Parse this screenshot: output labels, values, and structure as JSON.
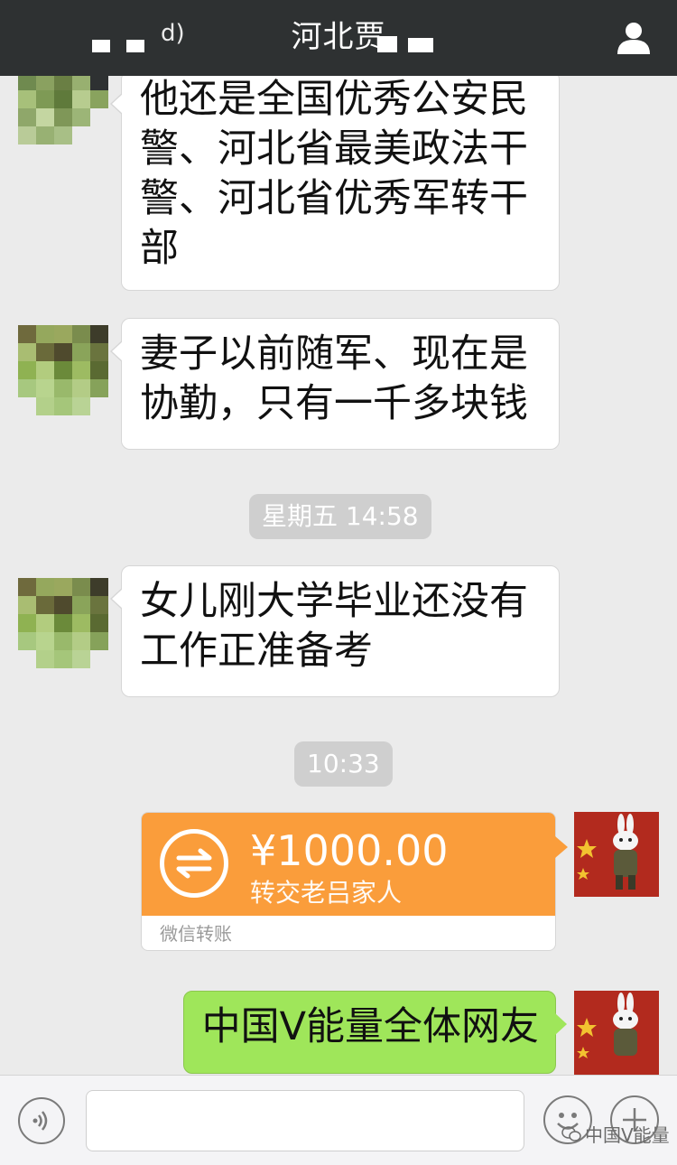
{
  "header": {
    "title": "河北贾",
    "left_label": "",
    "user_icon": "user-icon"
  },
  "messages": [
    {
      "side": "left",
      "text_lines": [
        "他还是全国优秀公安民",
        "警、河北省最美政法干",
        "警、河北省优秀军转干",
        "部"
      ]
    },
    {
      "side": "left",
      "text_lines": [
        "妻子以前随军、现在是",
        "协勤，只有一千多块钱"
      ]
    },
    {
      "timestamp": "星期五 14:58"
    },
    {
      "side": "left",
      "text_lines": [
        "女儿刚大学毕业还没有",
        "工作正准备考"
      ]
    },
    {
      "timestamp": "10:33"
    },
    {
      "side": "right",
      "transfer": {
        "amount": "¥1000.00",
        "note": "转交老吕家人",
        "footer": "微信转账"
      }
    },
    {
      "side": "right",
      "text_lines": [
        "中国V能量全体网友"
      ]
    }
  ],
  "bottom_bar": {
    "voice_icon": "voice-icon",
    "emoji_icon": "emoji-icon",
    "plus_icon": "plus-icon",
    "input_value": ""
  },
  "watermark": {
    "text": "中国V能量"
  },
  "colors": {
    "header_bg": "#2e3132",
    "chat_bg": "#ebebeb",
    "transfer_orange": "#fa9d3b",
    "sent_green": "#9fe65a"
  }
}
